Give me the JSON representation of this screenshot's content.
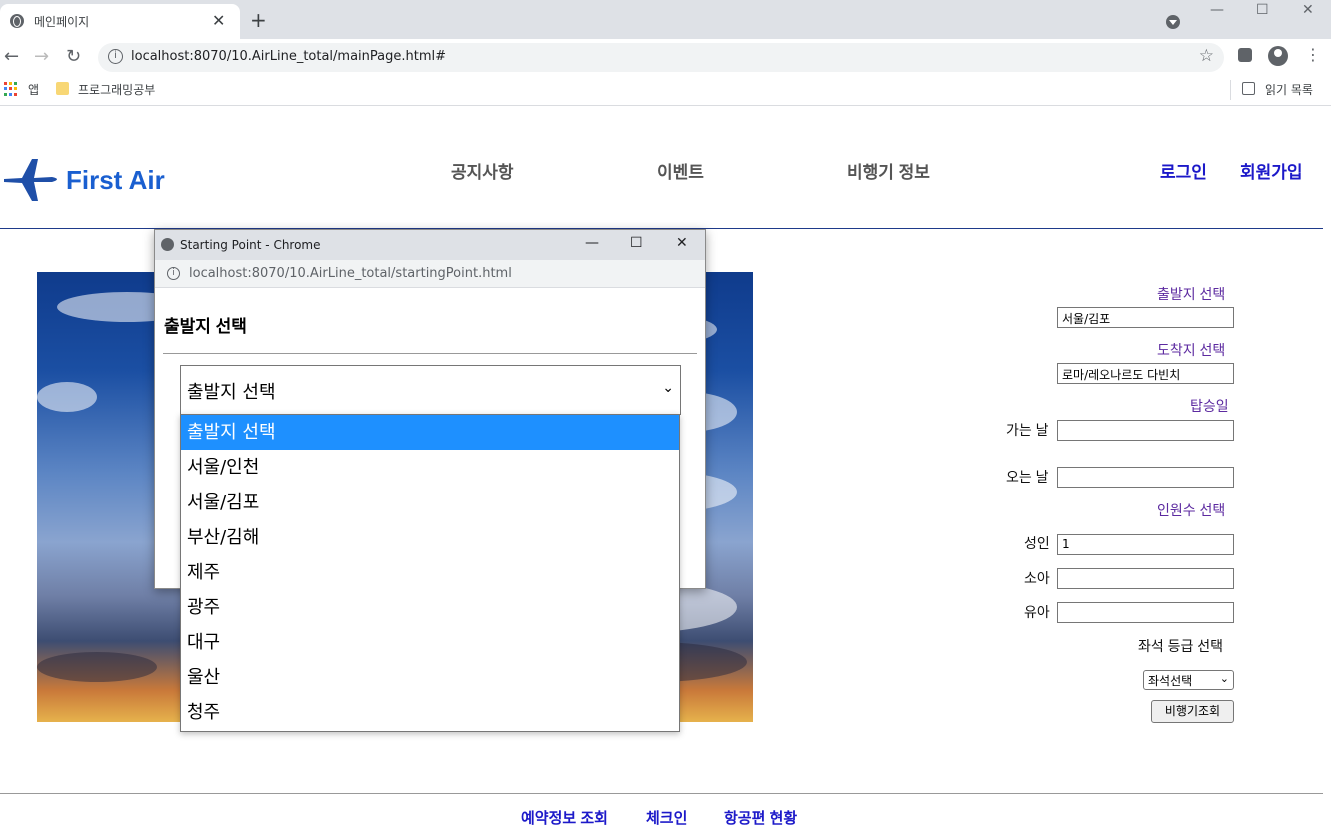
{
  "browser": {
    "tab_title": "메인페이지",
    "url": "localhost:8070/10.AirLine_total/mainPage.html#",
    "bookmarks": {
      "apps": "앱",
      "folder": "프로그래밍공부",
      "reading_list": "읽기 목록"
    }
  },
  "header": {
    "logo_text": "First Air",
    "nav": [
      "공지사항",
      "이벤트",
      "비행기 정보"
    ],
    "login": "로그인",
    "signup": "회원가입"
  },
  "form": {
    "departure_label": "출발지 선택",
    "departure_value": "서울/김포",
    "arrival_label": "도착지 선택",
    "arrival_value": "로마/레오나르도 다빈치",
    "boarding_label": "탑승일",
    "depart_date_label": "가는 날",
    "return_date_label": "오는 날",
    "passengers_label": "인원수 선택",
    "adult_label": "성인",
    "adult_value": "1",
    "child_label": "소아",
    "infant_label": "유아",
    "seat_label": "좌석 등급 선택",
    "seat_select_value": "좌석선택",
    "search_button": "비행기조회"
  },
  "footer": {
    "links": [
      "예약정보 조회",
      "체크인",
      "항공편 현황"
    ]
  },
  "popup": {
    "window_title": "Starting Point - Chrome",
    "url": "localhost:8070/10.AirLine_total/startingPoint.html",
    "heading": "출발지 선택",
    "select_value": "출발지 선택",
    "options": [
      "출발지 선택",
      "서울/인천",
      "서울/김포",
      "부산/김해",
      "제주",
      "광주",
      "대구",
      "울산",
      "청주"
    ],
    "selected_index": 0
  },
  "colors": {
    "accent_link": "#1c19c9",
    "form_label": "#5c2aa0",
    "logo": "#1a5fd0",
    "option_highlight": "#1e90ff"
  }
}
